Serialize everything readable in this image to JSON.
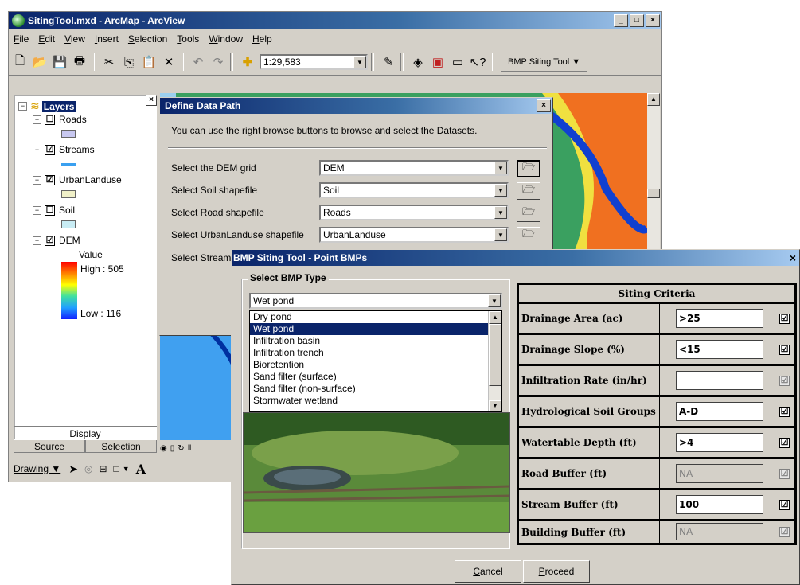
{
  "arcmap": {
    "title": "SitingTool.mxd - ArcMap - ArcView",
    "window_buttons": [
      "_",
      "□",
      "×"
    ],
    "menu": [
      "File",
      "Edit",
      "View",
      "Insert",
      "Selection",
      "Tools",
      "Window",
      "Help"
    ],
    "scale": "1:29,583",
    "bmp_tool_menu": "BMP Siting Tool ▼",
    "toc": {
      "root": "Layers",
      "layers": [
        {
          "name": "Roads",
          "checked": "☐",
          "swatch": "#c8c8f0"
        },
        {
          "name": "Streams",
          "checked": "☑",
          "swatch": "#3aa0f0"
        },
        {
          "name": "UrbanLanduse",
          "checked": "☑",
          "swatch": "#f0f0c8"
        },
        {
          "name": "Soil",
          "checked": "☐",
          "swatch": "#c8ecf4"
        }
      ],
      "dem": {
        "name": "DEM",
        "checked": "☑",
        "value_label": "Value",
        "high": "High : 505",
        "low": "Low : 116"
      },
      "display_tab": "Display",
      "source_tab": "Source",
      "selection_tab": "Selection"
    },
    "drawing_label": "Drawing ▼"
  },
  "define_data_path": {
    "title": "Define Data Path",
    "close": "×",
    "instructions": "You can use the right browse buttons to browse and select the Datasets.",
    "fields": [
      {
        "label": "Select the DEM grid",
        "value": "DEM"
      },
      {
        "label": "Select Soil shapefile",
        "value": "Soil"
      },
      {
        "label": "Select Road shapefile",
        "value": "Roads"
      },
      {
        "label": "Select UrbanLanduse shapefile",
        "value": "UrbanLanduse"
      },
      {
        "label": "Select Stream",
        "value": ""
      }
    ]
  },
  "bmp_dialog": {
    "title": "BMP Siting Tool - Point BMPs",
    "close": "×",
    "group_label": "Select BMP Type",
    "selected_type": "Wet pond",
    "options": [
      "Dry pond",
      "Wet pond",
      "Infiltration basin",
      "Infiltration trench",
      "Bioretention",
      "Sand filter (surface)",
      "Sand filter (non-surface)",
      "Stormwater wetland"
    ],
    "criteria_header": "Siting Criteria",
    "criteria": [
      {
        "label": "Drainage Area (ac)",
        "value": ">25",
        "enabled": true,
        "checked": "☑"
      },
      {
        "label": "Drainage Slope (%)",
        "value": "<15",
        "enabled": true,
        "checked": "☑"
      },
      {
        "label": "Infiltration Rate (in/hr)",
        "value": "",
        "enabled": true,
        "checked": "☑"
      },
      {
        "label": "Hydrological Soil Groups",
        "value": "A-D",
        "enabled": true,
        "checked": "☑"
      },
      {
        "label": "Watertable Depth (ft)",
        "value": ">4",
        "enabled": true,
        "checked": "☑"
      },
      {
        "label": "Road Buffer (ft)",
        "value": "NA",
        "enabled": false,
        "checked": "☑"
      },
      {
        "label": "Stream Buffer (ft)",
        "value": "100",
        "enabled": true,
        "checked": "☑"
      },
      {
        "label": "Building Buffer (ft)",
        "value": "NA",
        "enabled": false,
        "checked": "☑"
      }
    ],
    "cancel": "Cancel",
    "proceed": "Proceed"
  }
}
